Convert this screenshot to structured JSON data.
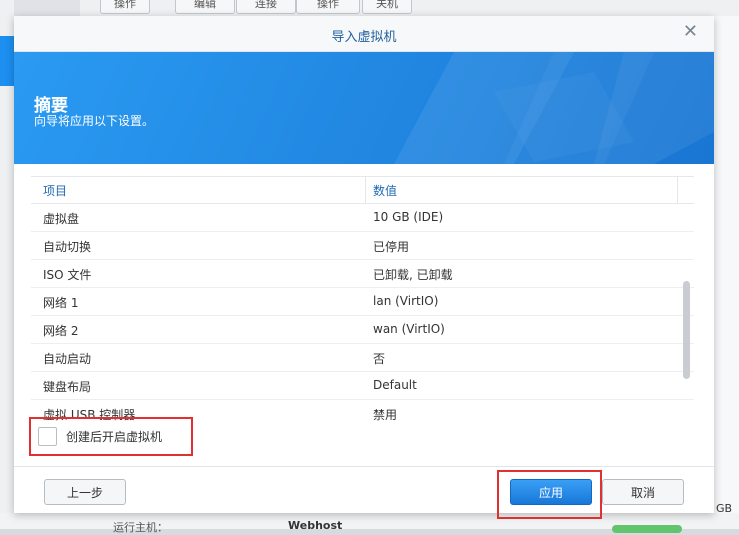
{
  "dialog": {
    "title": "导入虚拟机",
    "close_icon": "close-icon",
    "banner": {
      "heading": "摘要",
      "subheading": "向导将应用以下设置。"
    },
    "table": {
      "columns": [
        "项目",
        "数值"
      ],
      "rows": [
        {
          "item": "虚拟盘",
          "value": "10 GB (IDE)"
        },
        {
          "item": "自动切换",
          "value": "已停用"
        },
        {
          "item": "ISO 文件",
          "value": "已卸载, 已卸载"
        },
        {
          "item": "网络 1",
          "value": "lan (VirtIO)"
        },
        {
          "item": "网络 2",
          "value": "wan (VirtIO)"
        },
        {
          "item": "自动启动",
          "value": "否"
        },
        {
          "item": "键盘布局",
          "value": "Default"
        },
        {
          "item": "虚拟 USB 控制器",
          "value": "禁用"
        }
      ]
    },
    "checkbox_label": "创建后开启虚拟机",
    "buttons": {
      "back": "上一步",
      "apply": "应用",
      "cancel": "取消"
    }
  },
  "background": {
    "toolbar_buttons": [
      "操作",
      "编辑",
      "连接",
      "操作",
      "关机"
    ],
    "bottom_label": "运行主机：",
    "bottom_value": "Webhost",
    "right_unit": "GB"
  },
  "colors": {
    "accent": "#1c8ff0",
    "highlight_border": "#e0302f"
  }
}
